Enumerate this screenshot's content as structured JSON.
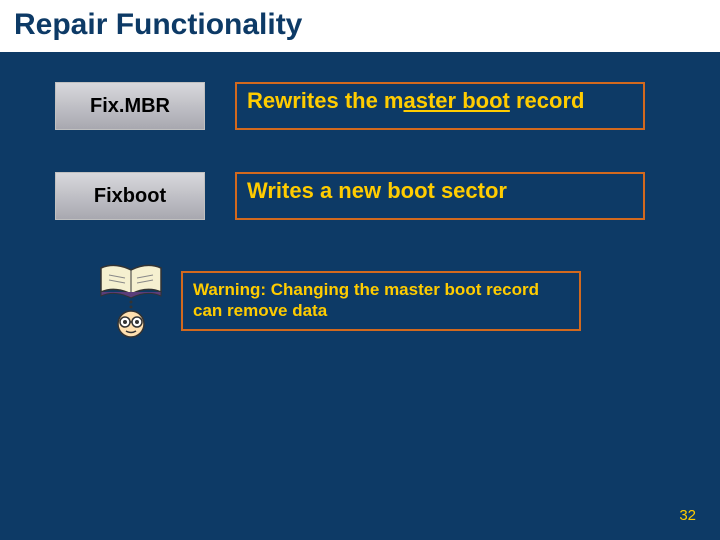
{
  "title": "Repair Functionality",
  "rows": [
    {
      "cmd": "Fix.MBR",
      "desc_pre": "Rewrites the m",
      "desc_link": "aster boot",
      "desc_post": " record"
    },
    {
      "cmd": "Fixboot",
      "desc_pre": "Writes a new boot sector",
      "desc_link": "",
      "desc_post": ""
    }
  ],
  "warning": "Warning: Changing the master boot record can remove data",
  "page_number": "32"
}
